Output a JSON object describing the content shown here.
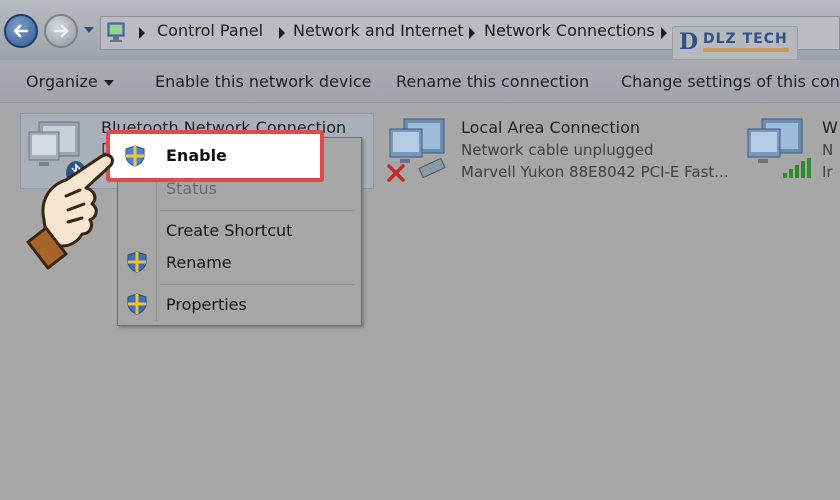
{
  "address_bar": {
    "breadcrumbs": [
      "Control Panel",
      "Network and Internet",
      "Network Connections"
    ],
    "icons": [
      "back-arrow-icon",
      "forward-arrow-icon",
      "control-panel-icon"
    ]
  },
  "logo": {
    "text": "DLZ TECH",
    "mark": "D"
  },
  "toolbar": {
    "organize": "Organize",
    "enable_device": "Enable this network device",
    "rename": "Rename this connection",
    "change_settings": "Change settings of this conne"
  },
  "connections": [
    {
      "title": "Bluetooth Network Connection",
      "status": "Di",
      "device": ""
    },
    {
      "title": "Local Area Connection",
      "status": "Network cable unplugged",
      "device": "Marvell Yukon 88E8042 PCI-E Fast..."
    },
    {
      "title": "W",
      "status": "N",
      "device": "Ir"
    }
  ],
  "context_menu": {
    "enable": "Enable",
    "status": "Status",
    "create_shortcut": "Create Shortcut",
    "rename": "Rename",
    "properties": "Properties"
  },
  "colors": {
    "highlight_border": "#e14a4a",
    "dim_background": "#a7a7a7",
    "brand": "#2e4f8a"
  }
}
